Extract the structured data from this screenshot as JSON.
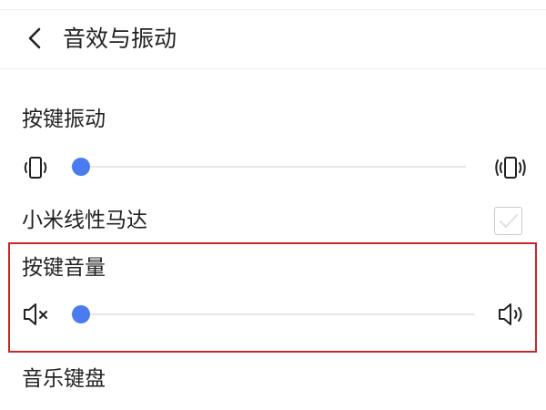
{
  "header": {
    "title": "音效与振动",
    "back_icon": "chevron-left-icon"
  },
  "key_vibration": {
    "label": "按键振动",
    "min_icon": "vibrate-low-icon",
    "max_icon": "vibrate-high-icon",
    "level": 0
  },
  "linear_motor": {
    "label": "小米线性马达",
    "checked": false
  },
  "key_volume": {
    "label": "按键音量",
    "min_icon": "volume-mute-icon",
    "max_icon": "volume-up-icon",
    "level": 0
  },
  "music_keyboard": {
    "label": "音乐键盘"
  },
  "colors": {
    "accent": "#4a7cf0",
    "highlight_border": "#c8262b",
    "track": "#e6e6e6",
    "text": "#222222"
  }
}
